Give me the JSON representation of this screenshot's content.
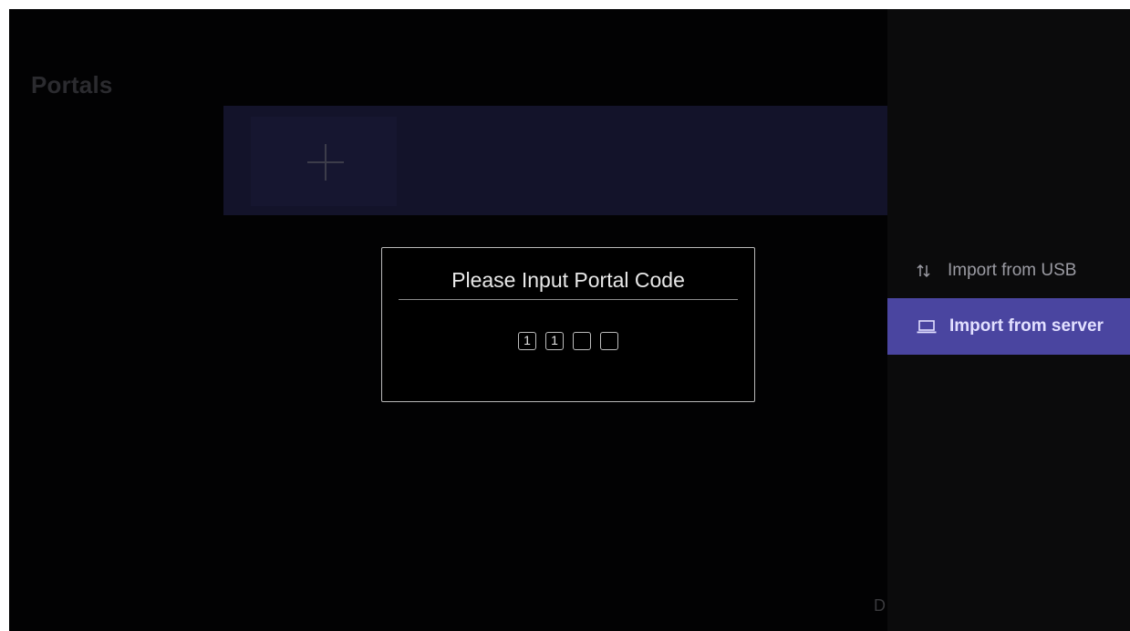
{
  "page": {
    "title": "Portals",
    "bottom_letter": "D"
  },
  "side_menu": {
    "items": [
      {
        "label": "Import from USB",
        "icon": "sort-arrows-icon",
        "selected": false
      },
      {
        "label": "Import from server",
        "icon": "laptop-icon",
        "selected": true
      }
    ],
    "accent_color": "#4a45a0"
  },
  "dialog": {
    "title": "Please Input Portal Code",
    "code_digits": [
      "1",
      "1",
      "",
      ""
    ]
  }
}
